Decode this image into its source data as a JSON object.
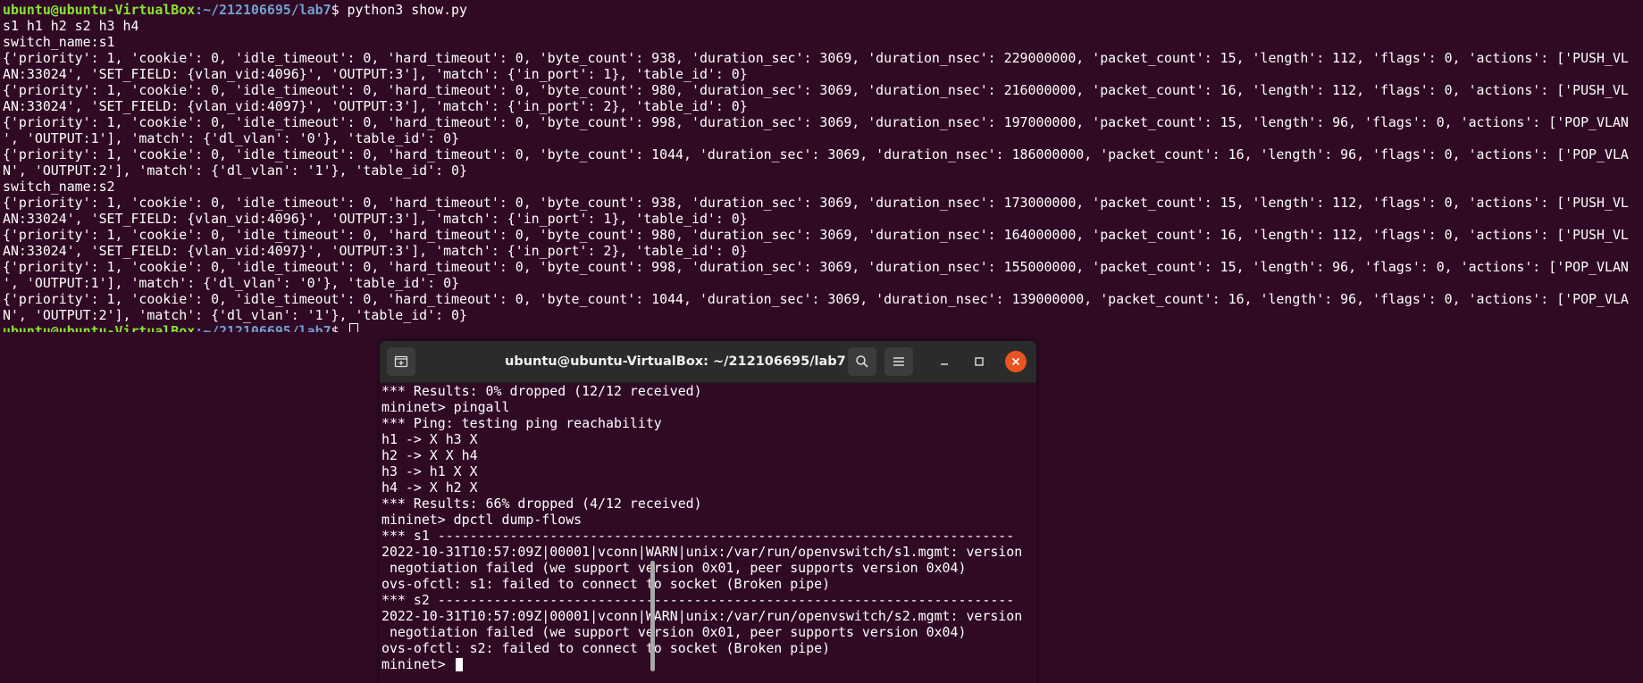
{
  "bg_terminal": {
    "prompt_user": "ubuntu@ubuntu-VirtualBox",
    "prompt_path": ":~/212106695/lab7",
    "prompt_suffix": "$ ",
    "command": "python3 show.py",
    "output": [
      "s1 h1 h2 s2 h3 h4",
      "switch_name:s1",
      "{'priority': 1, 'cookie': 0, 'idle_timeout': 0, 'hard_timeout': 0, 'byte_count': 938, 'duration_sec': 3069, 'duration_nsec': 229000000, 'packet_count': 15, 'length': 112, 'flags': 0, 'actions': ['PUSH_VL",
      "AN:33024', 'SET_FIELD: {vlan_vid:4096}', 'OUTPUT:3'], 'match': {'in_port': 1}, 'table_id': 0}",
      "{'priority': 1, 'cookie': 0, 'idle_timeout': 0, 'hard_timeout': 0, 'byte_count': 980, 'duration_sec': 3069, 'duration_nsec': 216000000, 'packet_count': 16, 'length': 112, 'flags': 0, 'actions': ['PUSH_VL",
      "AN:33024', 'SET_FIELD: {vlan_vid:4097}', 'OUTPUT:3'], 'match': {'in_port': 2}, 'table_id': 0}",
      "{'priority': 1, 'cookie': 0, 'idle_timeout': 0, 'hard_timeout': 0, 'byte_count': 998, 'duration_sec': 3069, 'duration_nsec': 197000000, 'packet_count': 15, 'length': 96, 'flags': 0, 'actions': ['POP_VLAN",
      "', 'OUTPUT:1'], 'match': {'dl_vlan': '0'}, 'table_id': 0}",
      "{'priority': 1, 'cookie': 0, 'idle_timeout': 0, 'hard_timeout': 0, 'byte_count': 1044, 'duration_sec': 3069, 'duration_nsec': 186000000, 'packet_count': 16, 'length': 96, 'flags': 0, 'actions': ['POP_VLA",
      "N', 'OUTPUT:2'], 'match': {'dl_vlan': '1'}, 'table_id': 0}",
      "switch_name:s2",
      "{'priority': 1, 'cookie': 0, 'idle_timeout': 0, 'hard_timeout': 0, 'byte_count': 938, 'duration_sec': 3069, 'duration_nsec': 173000000, 'packet_count': 15, 'length': 112, 'flags': 0, 'actions': ['PUSH_VL",
      "AN:33024', 'SET_FIELD: {vlan_vid:4096}', 'OUTPUT:3'], 'match': {'in_port': 1}, 'table_id': 0}",
      "{'priority': 1, 'cookie': 0, 'idle_timeout': 0, 'hard_timeout': 0, 'byte_count': 980, 'duration_sec': 3069, 'duration_nsec': 164000000, 'packet_count': 16, 'length': 112, 'flags': 0, 'actions': ['PUSH_VL",
      "AN:33024', 'SET_FIELD: {vlan_vid:4097}', 'OUTPUT:3'], 'match': {'in_port': 2}, 'table_id': 0}",
      "{'priority': 1, 'cookie': 0, 'idle_timeout': 0, 'hard_timeout': 0, 'byte_count': 998, 'duration_sec': 3069, 'duration_nsec': 155000000, 'packet_count': 15, 'length': 96, 'flags': 0, 'actions': ['POP_VLAN",
      "', 'OUTPUT:1'], 'match': {'dl_vlan': '0'}, 'table_id': 0}",
      "{'priority': 1, 'cookie': 0, 'idle_timeout': 0, 'hard_timeout': 0, 'byte_count': 1044, 'duration_sec': 3069, 'duration_nsec': 139000000, 'packet_count': 16, 'length': 96, 'flags': 0, 'actions': ['POP_VLA",
      "N', 'OUTPUT:2'], 'match': {'dl_vlan': '1'}, 'table_id': 0}"
    ]
  },
  "front_window": {
    "title": "ubuntu@ubuntu-VirtualBox: ~/212106695/lab7",
    "icons": {
      "new_tab": "new-tab-icon",
      "search": "search-icon",
      "menu": "hamburger-menu-icon",
      "minimize": "minimize-icon",
      "maximize": "maximize-icon",
      "close": "close-icon"
    },
    "accent_close": "#e95420",
    "lines": [
      "*** Results: 0% dropped (12/12 received)",
      "mininet> pingall",
      "*** Ping: testing ping reachability",
      "h1 -> X h3 X",
      "h2 -> X X h4",
      "h3 -> h1 X X",
      "h4 -> X h2 X",
      "*** Results: 66% dropped (4/12 received)",
      "mininet> dpctl dump-flows",
      "*** s1 ------------------------------------------------------------------------",
      "2022-10-31T10:57:09Z|00001|vconn|WARN|unix:/var/run/openvswitch/s1.mgmt: version",
      " negotiation failed (we support version 0x01, peer supports version 0x04)",
      "ovs-ofctl: s1: failed to connect to socket (Broken pipe)",
      "*** s2 ------------------------------------------------------------------------",
      "2022-10-31T10:57:09Z|00001|vconn|WARN|unix:/var/run/openvswitch/s2.mgmt: version",
      " negotiation failed (we support version 0x01, peer supports version 0x04)",
      "ovs-ofctl: s2: failed to connect to socket (Broken pipe)"
    ],
    "prompt": "mininet> "
  }
}
